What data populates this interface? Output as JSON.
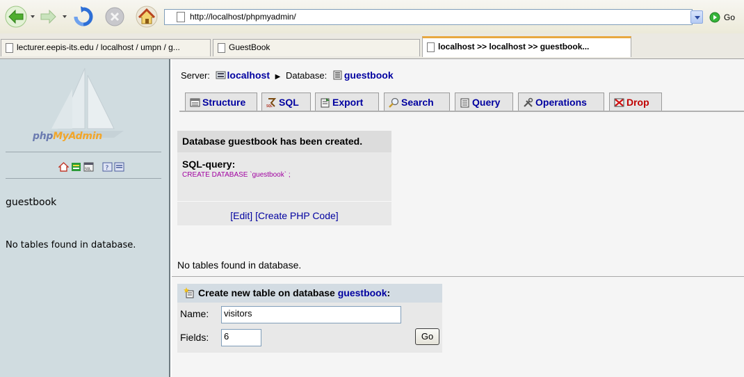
{
  "browser": {
    "address_url": "http://localhost/phpmyadmin/",
    "go_label": "Go"
  },
  "tabs": [
    {
      "label": "lecturer.eepis-its.edu / localhost / umpn / g..."
    },
    {
      "label": "GuestBook"
    },
    {
      "label": "localhost >> localhost >> guestbook..."
    }
  ],
  "sidebar": {
    "logo_part1": "php",
    "logo_part2": "MyAdmin",
    "database": "guestbook",
    "no_tables": "No tables found in database."
  },
  "main": {
    "breadcrumb": {
      "server_label": "Server:",
      "server": "localhost",
      "database_label": "Database:",
      "database": "guestbook"
    },
    "tabs": [
      {
        "label": "Structure"
      },
      {
        "label": "SQL"
      },
      {
        "label": "Export"
      },
      {
        "label": "Search"
      },
      {
        "label": "Query"
      },
      {
        "label": "Operations"
      },
      {
        "label": "Drop"
      }
    ],
    "notice": {
      "title": "Database guestbook has been created.",
      "sql_label": "SQL-query:",
      "sql": "CREATE DATABASE `guestbook` ;",
      "edit_link": "[Edit]",
      "php_link": "[Create PHP Code]"
    },
    "no_tables": "No tables found in database.",
    "create_table": {
      "title": "Create new table on database ",
      "database": "guestbook",
      "colon": ":",
      "name_label": "Name:",
      "name_value": "visitors",
      "fields_label": "Fields:",
      "fields_value": "6",
      "go_label": "Go"
    }
  },
  "colors": {
    "link": "#0000a0",
    "sql": "#a000a0",
    "sidebar_bg": "#d0dce0",
    "active_tab_accent": "#e8a840"
  },
  "icons": [
    "back-icon",
    "forward-icon",
    "refresh-icon",
    "stop-icon",
    "home-icon",
    "page-icon",
    "go-icon",
    "phpmyadmin-logo-ship",
    "structure-icon",
    "sql-icon",
    "export-icon",
    "search-icon",
    "query-icon",
    "operations-icon",
    "drop-icon",
    "new-table-icon"
  ]
}
